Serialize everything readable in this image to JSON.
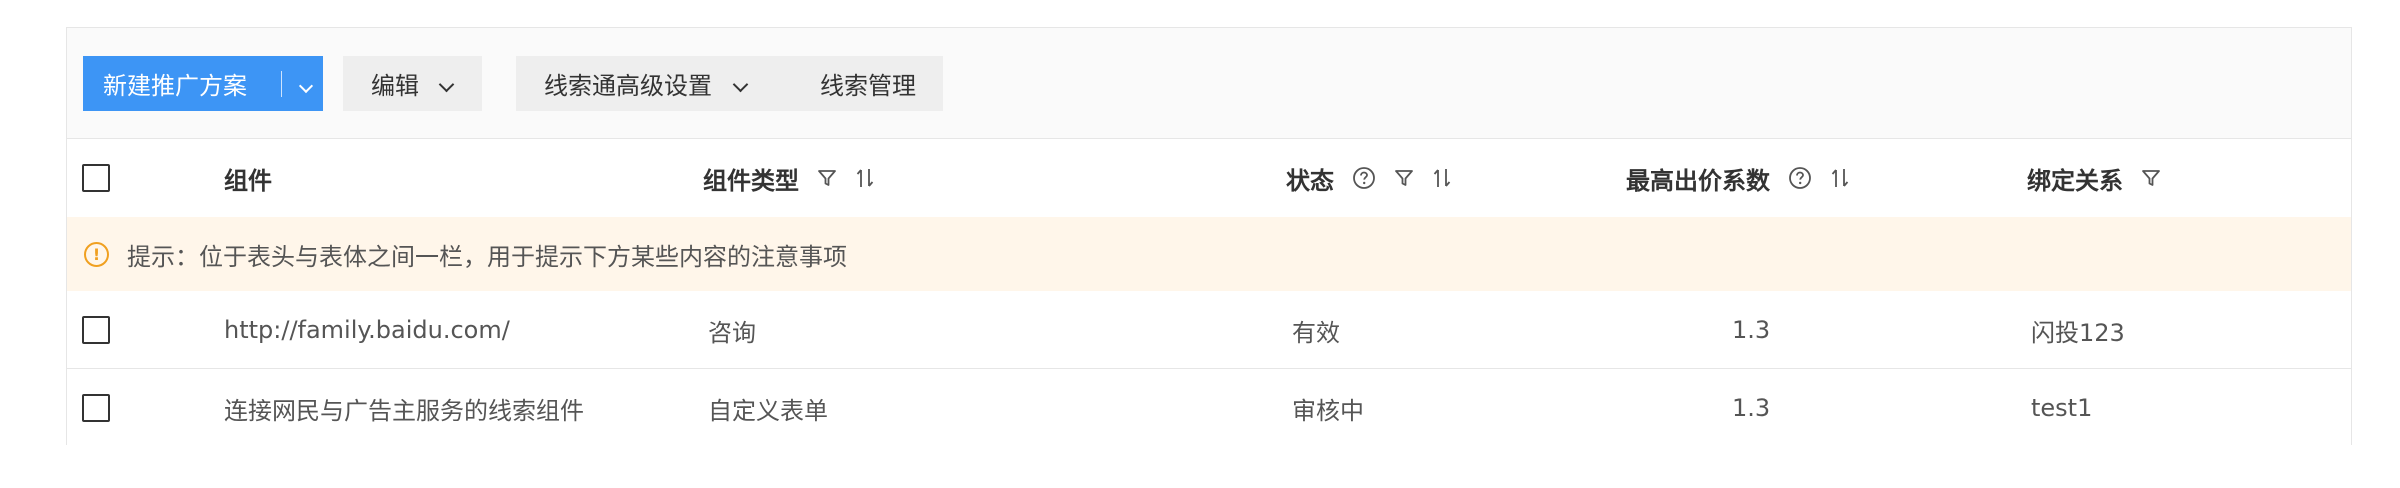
{
  "toolbar": {
    "new_plan_label": "新建推广方案",
    "edit_label": "编辑",
    "advanced_settings_label": "线索通高级设置",
    "lead_management_label": "线索管理"
  },
  "table": {
    "columns": {
      "component": "组件",
      "component_type": "组件类型",
      "status": "状态",
      "max_bid_coefficient": "最高出价系数",
      "binding": "绑定关系"
    },
    "hint": "提示：位于表头与表体之间一栏，用于提示下方某些内容的注意事项",
    "rows": [
      {
        "component": "http://family.baidu.com/",
        "component_type": "咨询",
        "status": "有效",
        "max_bid_coefficient": "1.3",
        "binding": "闪投123"
      },
      {
        "component": "连接网民与广告主服务的线索组件",
        "component_type": "自定义表单",
        "status": "审核中",
        "max_bid_coefficient": "1.3",
        "binding": "test1"
      }
    ]
  },
  "icons": {
    "filter": "filter-icon",
    "sort": "sort-icon",
    "help": "help-circle-icon",
    "warning": "warning-circle-icon",
    "dropdown": "chevron-down-icon"
  },
  "colors": {
    "primary": "#3d95f5",
    "hint_background": "#fff6ea",
    "warning": "#f0a020"
  }
}
